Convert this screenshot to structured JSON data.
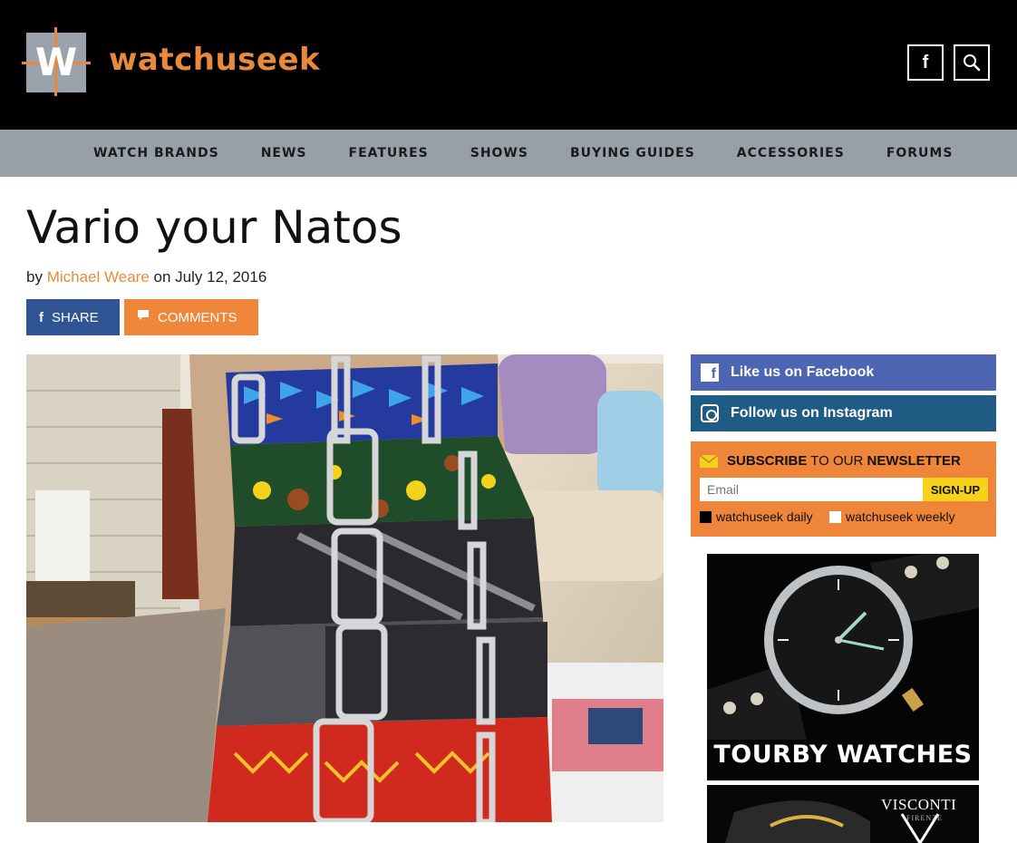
{
  "site": {
    "name": "watchuseek",
    "logo_letter": "W"
  },
  "header": {
    "icons": [
      "facebook-icon",
      "search-icon"
    ]
  },
  "nav": [
    "WATCH BRANDS",
    "NEWS",
    "FEATURES",
    "SHOWS",
    "BUYING GUIDES",
    "ACCESSORIES",
    "FORUMS"
  ],
  "article": {
    "title": "Vario your Natos",
    "by": "by",
    "author": "Michael Weare",
    "date_prefix": "on",
    "date": "July 12, 2016",
    "share_label": "SHARE",
    "comments_label": "COMMENTS"
  },
  "sidebar": {
    "facebook_label": "Like us on Facebook",
    "instagram_label": "Follow us on Instagram",
    "newsletter": {
      "subscribe_word": "SUBSCRIBE",
      "to_our": " TO OUR ",
      "newsletter_word": "NEWSLETTER",
      "email_placeholder": "Email",
      "signup_label": "SIGN-UP",
      "opt_daily": "watchuseek daily",
      "opt_weekly": "watchuseek weekly"
    },
    "ad1_caption": "TOURBY WATCHES",
    "ad2_brand": "VISCONTI",
    "ad2_sub": "FIRENZE"
  },
  "colors": {
    "accent": "#e98a3b",
    "nav_bg": "#97a0a9",
    "share_bg": "#2f5595",
    "facebook_bg": "#4d65b2",
    "instagram_bg": "#1f5b83",
    "newsletter_bg": "#ef8539"
  }
}
